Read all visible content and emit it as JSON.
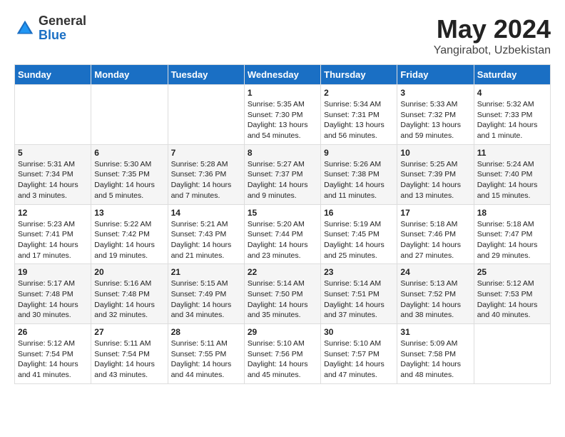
{
  "logo": {
    "general": "General",
    "blue": "Blue"
  },
  "title": {
    "month_year": "May 2024",
    "location": "Yangirabot, Uzbekistan"
  },
  "weekdays": [
    "Sunday",
    "Monday",
    "Tuesday",
    "Wednesday",
    "Thursday",
    "Friday",
    "Saturday"
  ],
  "weeks": [
    [
      {
        "day": "",
        "info": ""
      },
      {
        "day": "",
        "info": ""
      },
      {
        "day": "",
        "info": ""
      },
      {
        "day": "1",
        "info": "Sunrise: 5:35 AM\nSunset: 7:30 PM\nDaylight: 13 hours\nand 54 minutes."
      },
      {
        "day": "2",
        "info": "Sunrise: 5:34 AM\nSunset: 7:31 PM\nDaylight: 13 hours\nand 56 minutes."
      },
      {
        "day": "3",
        "info": "Sunrise: 5:33 AM\nSunset: 7:32 PM\nDaylight: 13 hours\nand 59 minutes."
      },
      {
        "day": "4",
        "info": "Sunrise: 5:32 AM\nSunset: 7:33 PM\nDaylight: 14 hours\nand 1 minute."
      }
    ],
    [
      {
        "day": "5",
        "info": "Sunrise: 5:31 AM\nSunset: 7:34 PM\nDaylight: 14 hours\nand 3 minutes."
      },
      {
        "day": "6",
        "info": "Sunrise: 5:30 AM\nSunset: 7:35 PM\nDaylight: 14 hours\nand 5 minutes."
      },
      {
        "day": "7",
        "info": "Sunrise: 5:28 AM\nSunset: 7:36 PM\nDaylight: 14 hours\nand 7 minutes."
      },
      {
        "day": "8",
        "info": "Sunrise: 5:27 AM\nSunset: 7:37 PM\nDaylight: 14 hours\nand 9 minutes."
      },
      {
        "day": "9",
        "info": "Sunrise: 5:26 AM\nSunset: 7:38 PM\nDaylight: 14 hours\nand 11 minutes."
      },
      {
        "day": "10",
        "info": "Sunrise: 5:25 AM\nSunset: 7:39 PM\nDaylight: 14 hours\nand 13 minutes."
      },
      {
        "day": "11",
        "info": "Sunrise: 5:24 AM\nSunset: 7:40 PM\nDaylight: 14 hours\nand 15 minutes."
      }
    ],
    [
      {
        "day": "12",
        "info": "Sunrise: 5:23 AM\nSunset: 7:41 PM\nDaylight: 14 hours\nand 17 minutes."
      },
      {
        "day": "13",
        "info": "Sunrise: 5:22 AM\nSunset: 7:42 PM\nDaylight: 14 hours\nand 19 minutes."
      },
      {
        "day": "14",
        "info": "Sunrise: 5:21 AM\nSunset: 7:43 PM\nDaylight: 14 hours\nand 21 minutes."
      },
      {
        "day": "15",
        "info": "Sunrise: 5:20 AM\nSunset: 7:44 PM\nDaylight: 14 hours\nand 23 minutes."
      },
      {
        "day": "16",
        "info": "Sunrise: 5:19 AM\nSunset: 7:45 PM\nDaylight: 14 hours\nand 25 minutes."
      },
      {
        "day": "17",
        "info": "Sunrise: 5:18 AM\nSunset: 7:46 PM\nDaylight: 14 hours\nand 27 minutes."
      },
      {
        "day": "18",
        "info": "Sunrise: 5:18 AM\nSunset: 7:47 PM\nDaylight: 14 hours\nand 29 minutes."
      }
    ],
    [
      {
        "day": "19",
        "info": "Sunrise: 5:17 AM\nSunset: 7:48 PM\nDaylight: 14 hours\nand 30 minutes."
      },
      {
        "day": "20",
        "info": "Sunrise: 5:16 AM\nSunset: 7:48 PM\nDaylight: 14 hours\nand 32 minutes."
      },
      {
        "day": "21",
        "info": "Sunrise: 5:15 AM\nSunset: 7:49 PM\nDaylight: 14 hours\nand 34 minutes."
      },
      {
        "day": "22",
        "info": "Sunrise: 5:14 AM\nSunset: 7:50 PM\nDaylight: 14 hours\nand 35 minutes."
      },
      {
        "day": "23",
        "info": "Sunrise: 5:14 AM\nSunset: 7:51 PM\nDaylight: 14 hours\nand 37 minutes."
      },
      {
        "day": "24",
        "info": "Sunrise: 5:13 AM\nSunset: 7:52 PM\nDaylight: 14 hours\nand 38 minutes."
      },
      {
        "day": "25",
        "info": "Sunrise: 5:12 AM\nSunset: 7:53 PM\nDaylight: 14 hours\nand 40 minutes."
      }
    ],
    [
      {
        "day": "26",
        "info": "Sunrise: 5:12 AM\nSunset: 7:54 PM\nDaylight: 14 hours\nand 41 minutes."
      },
      {
        "day": "27",
        "info": "Sunrise: 5:11 AM\nSunset: 7:54 PM\nDaylight: 14 hours\nand 43 minutes."
      },
      {
        "day": "28",
        "info": "Sunrise: 5:11 AM\nSunset: 7:55 PM\nDaylight: 14 hours\nand 44 minutes."
      },
      {
        "day": "29",
        "info": "Sunrise: 5:10 AM\nSunset: 7:56 PM\nDaylight: 14 hours\nand 45 minutes."
      },
      {
        "day": "30",
        "info": "Sunrise: 5:10 AM\nSunset: 7:57 PM\nDaylight: 14 hours\nand 47 minutes."
      },
      {
        "day": "31",
        "info": "Sunrise: 5:09 AM\nSunset: 7:58 PM\nDaylight: 14 hours\nand 48 minutes."
      },
      {
        "day": "",
        "info": ""
      }
    ]
  ]
}
